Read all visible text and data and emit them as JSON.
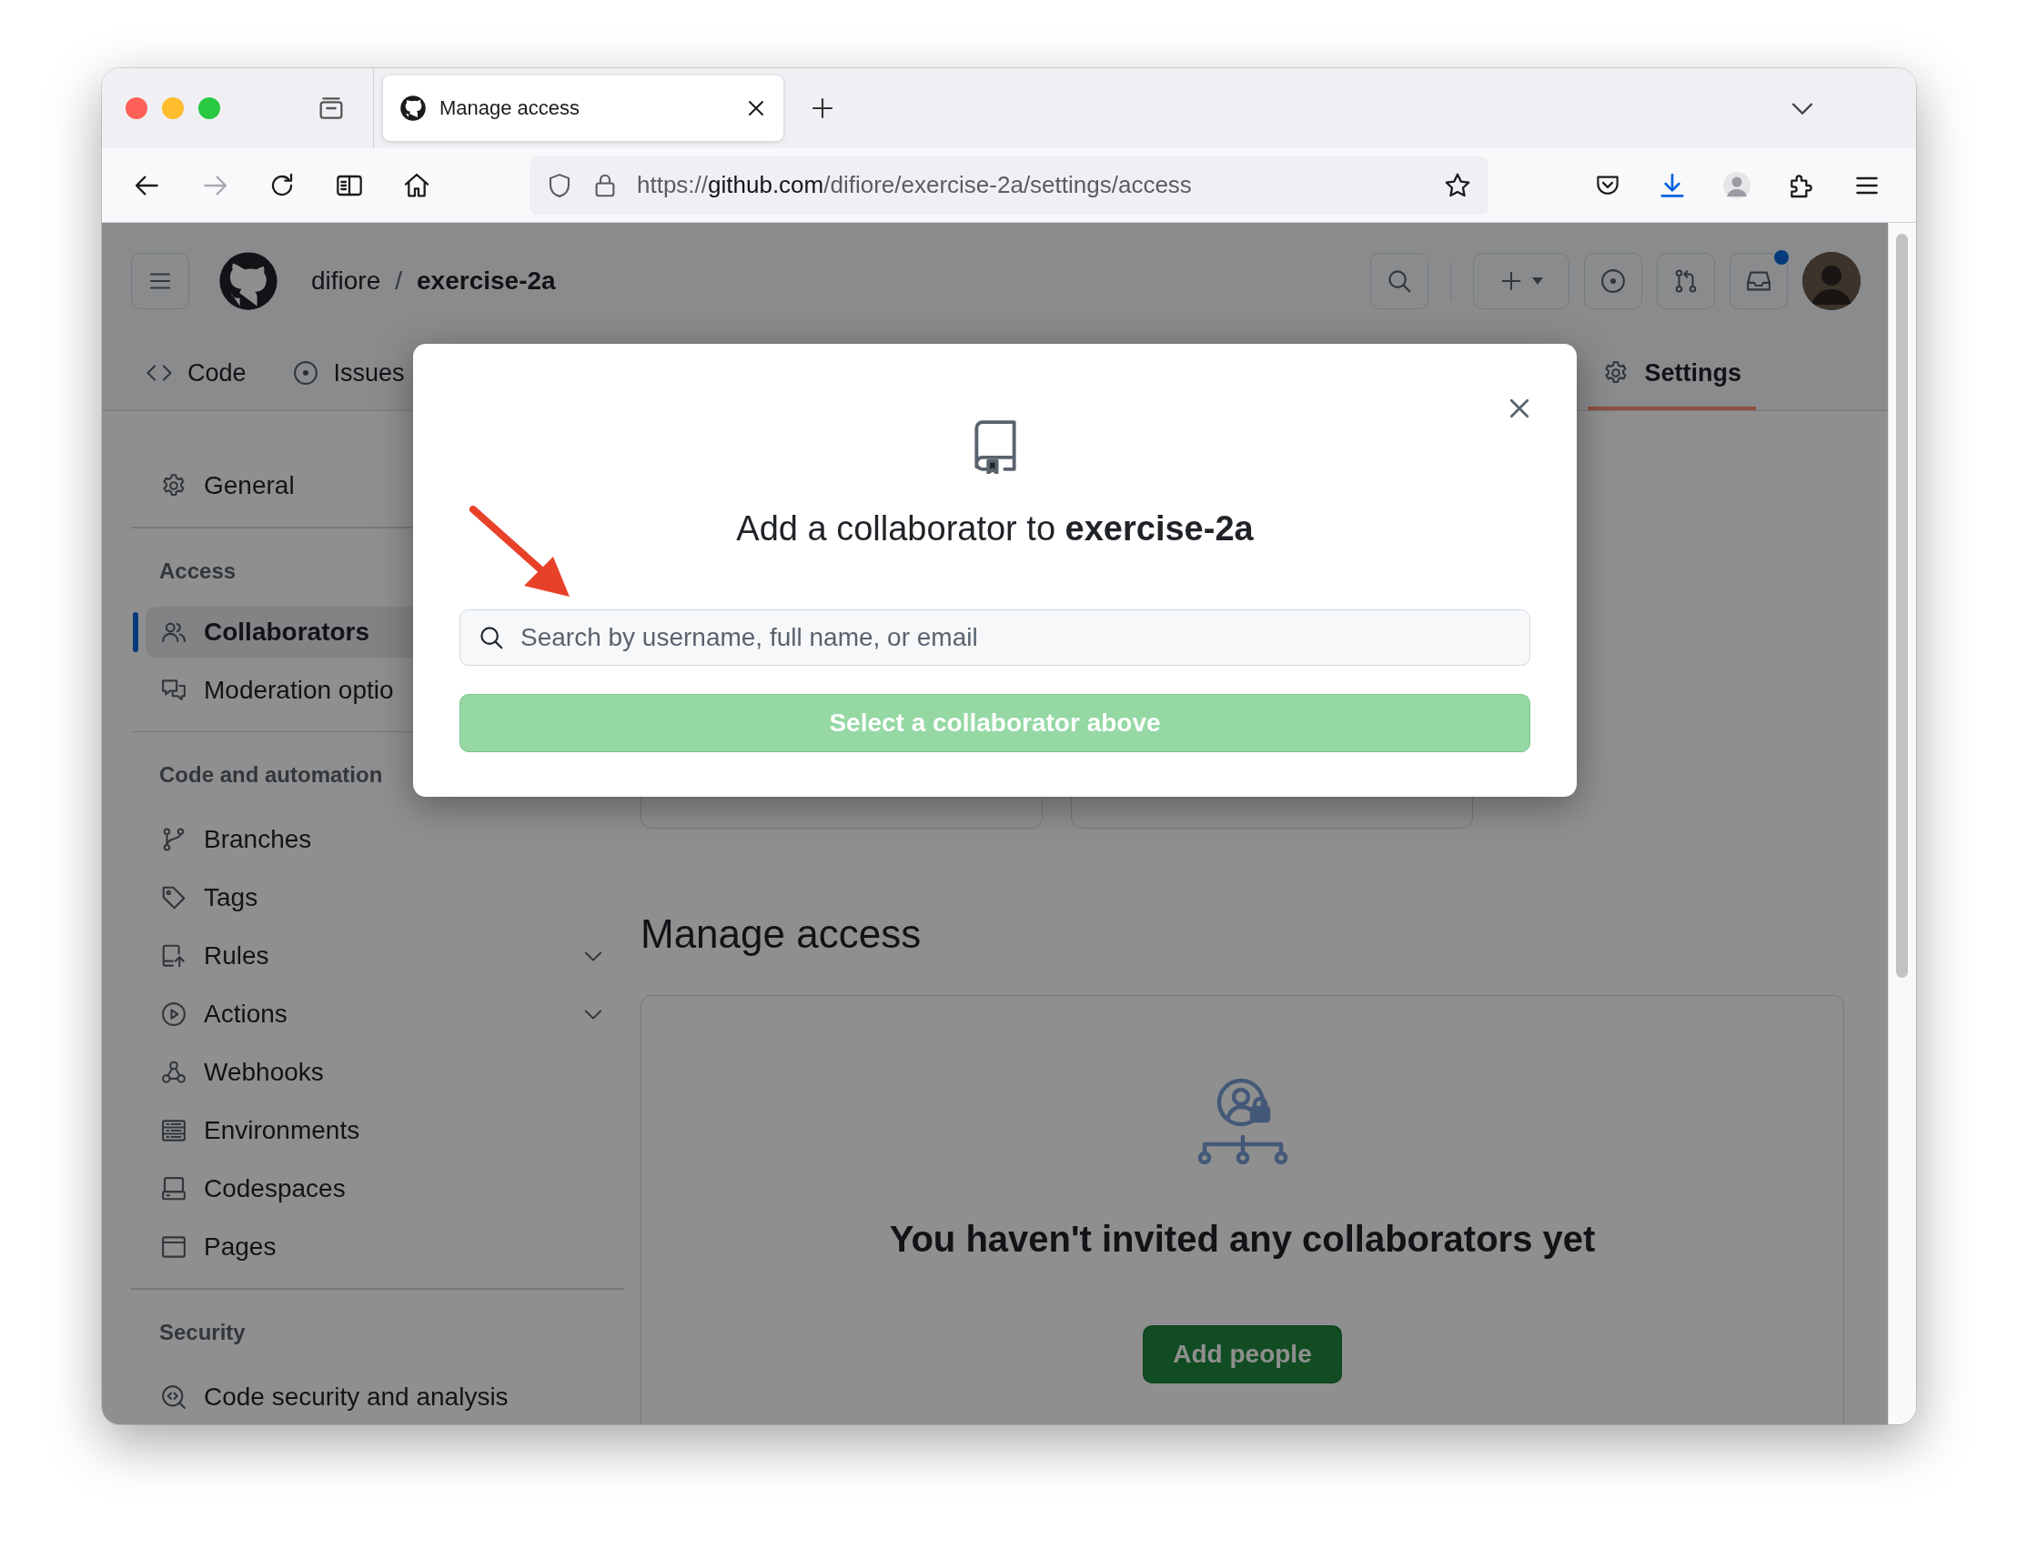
{
  "browser": {
    "tab": {
      "title": "Manage access"
    },
    "url": {
      "prefix": "https://",
      "host": "github.com",
      "path": "/difiore/exercise-2a/settings/access"
    }
  },
  "header": {
    "owner": "difiore",
    "separator": "/",
    "repo": "exercise-2a",
    "inbox_unread": true
  },
  "repo_tabs": [
    {
      "label": "Code",
      "selected": false
    },
    {
      "label": "Issues",
      "selected": false
    },
    {
      "label": "Settings",
      "selected": true
    }
  ],
  "sidebar": {
    "sections": [
      {
        "items": [
          {
            "label": "General",
            "selected": false,
            "expandable": false
          }
        ]
      },
      {
        "heading": "Access",
        "items": [
          {
            "label": "Collaborators",
            "selected": true,
            "expandable": false
          },
          {
            "label": "Moderation optio",
            "selected": false,
            "expandable": false
          }
        ]
      },
      {
        "heading": "Code and automation",
        "items": [
          {
            "label": "Branches",
            "selected": false,
            "expandable": false
          },
          {
            "label": "Tags",
            "selected": false,
            "expandable": false
          },
          {
            "label": "Rules",
            "selected": false,
            "expandable": true
          },
          {
            "label": "Actions",
            "selected": false,
            "expandable": true
          },
          {
            "label": "Webhooks",
            "selected": false,
            "expandable": false
          },
          {
            "label": "Environments",
            "selected": false,
            "expandable": false
          },
          {
            "label": "Codespaces",
            "selected": false,
            "expandable": false
          },
          {
            "label": "Pages",
            "selected": false,
            "expandable": false
          }
        ]
      },
      {
        "heading": "Security",
        "items": [
          {
            "label": "Code security and analysis",
            "selected": false,
            "expandable": false
          }
        ]
      }
    ]
  },
  "main": {
    "heading": "Manage access",
    "empty_state": {
      "message": "You haven't invited any collaborators yet",
      "button": "Add people"
    }
  },
  "dialog": {
    "title": "Add a collaborator to **exercise-2a**",
    "search": {
      "placeholder": "Search by username, full name, or email"
    },
    "submit": {
      "label": "Select a collaborator above",
      "disabled": true
    }
  }
}
